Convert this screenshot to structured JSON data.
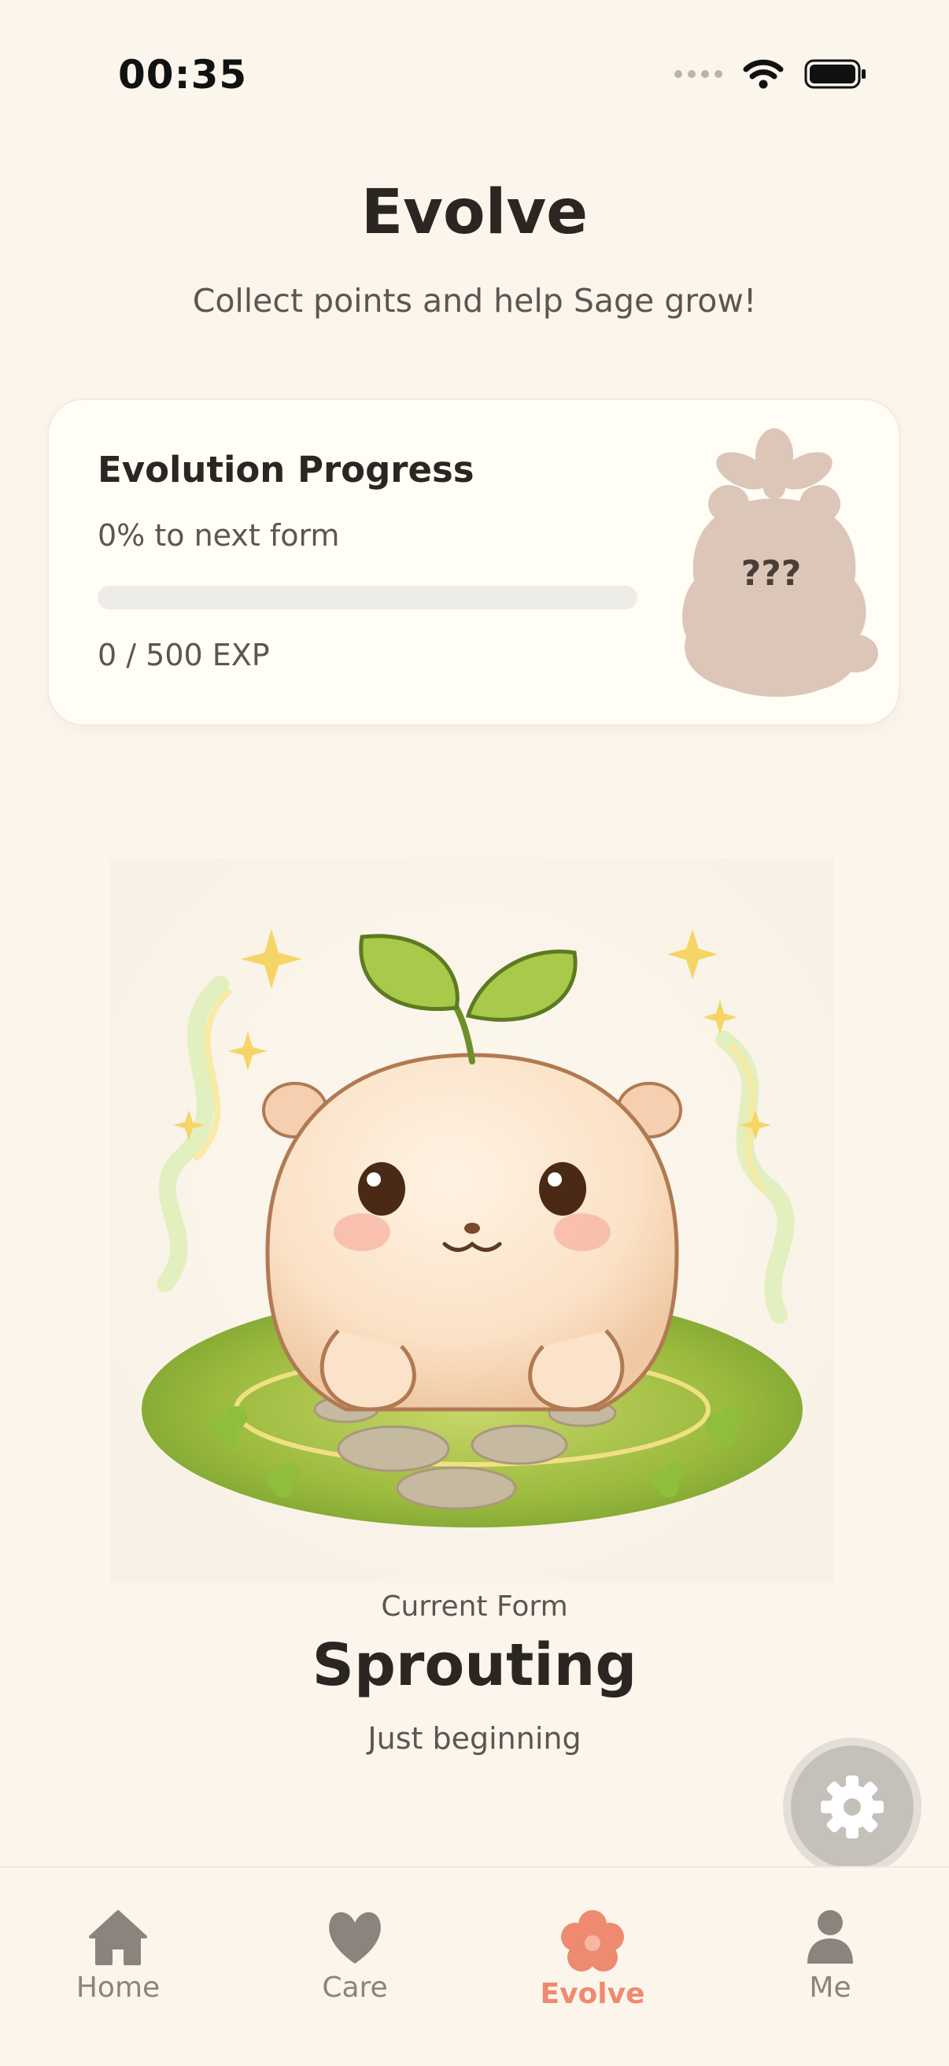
{
  "status_bar": {
    "time": "00:35",
    "icons": [
      "signal-dots-icon",
      "wifi-icon",
      "battery-icon"
    ]
  },
  "header": {
    "title": "Evolve",
    "subtitle": "Collect points and help Sage grow!"
  },
  "progress_card": {
    "title": "Evolution Progress",
    "percent_label": "0% to next form",
    "progress": 0,
    "exp_label": "0 / 500 EXP",
    "next_form_label": "???"
  },
  "pet": {
    "illustration": "sprouting-pet-illustration",
    "caption": "Current Form",
    "form_name": "Sprouting",
    "form_description": "Just beginning"
  },
  "settings": {
    "icon": "gear-icon"
  },
  "tabs": [
    {
      "label": "Home",
      "icon": "home-icon",
      "active": false
    },
    {
      "label": "Care",
      "icon": "heart-icon",
      "active": false
    },
    {
      "label": "Evolve",
      "icon": "flower-icon",
      "active": true
    },
    {
      "label": "Me",
      "icon": "person-icon",
      "active": false
    }
  ],
  "colors": {
    "background": "#fbf5ec",
    "accent": "#ee8a6f",
    "inactive": "#8b847d",
    "silhouette": "#dcc6b8"
  }
}
